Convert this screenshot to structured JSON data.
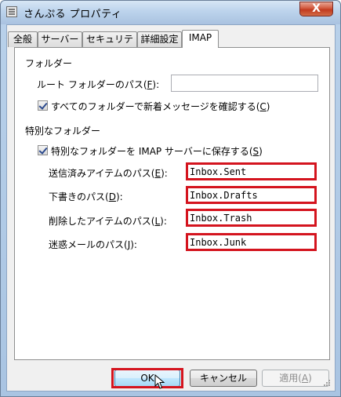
{
  "window": {
    "title": "さんぷる プロパティ",
    "close_glyph": "X"
  },
  "tabs": [
    {
      "label": "全般",
      "active": false
    },
    {
      "label": "サーバー",
      "active": false
    },
    {
      "label": "セキュリティ",
      "active": false
    },
    {
      "label": "詳細設定",
      "active": false
    },
    {
      "label": "IMAP",
      "active": true
    }
  ],
  "folders_group": {
    "heading": "フォルダー",
    "root_folder_label_pre": "ルート フォルダーのパス(",
    "root_folder_label_key": "F",
    "root_folder_label_post": "):",
    "root_folder_value": "",
    "check_all_label_pre": "すべてのフォルダーで新着メッセージを確認する(",
    "check_all_label_key": "C",
    "check_all_label_post": ")",
    "check_all_checked": true
  },
  "special_group": {
    "heading": "特別なフォルダー",
    "store_label_pre": "特別なフォルダーを IMAP サーバーに保存する(",
    "store_label_key": "S",
    "store_label_post": ")",
    "store_checked": true,
    "fields": [
      {
        "label_pre": "送信済みアイテムのパス(",
        "key": "E",
        "label_post": "):",
        "value": "Inbox.Sent"
      },
      {
        "label_pre": "下書きのパス(",
        "key": "D",
        "label_post": "):",
        "value": "Inbox.Drafts"
      },
      {
        "label_pre": "削除したアイテムのパス(",
        "key": "L",
        "label_post": "):",
        "value": "Inbox.Trash"
      },
      {
        "label_pre": "迷惑メールのパス(",
        "key": "J",
        "label_post": "):",
        "value": "Inbox.Junk"
      }
    ]
  },
  "buttons": {
    "ok": "OK",
    "cancel": "キャンセル",
    "apply_pre": "適用(",
    "apply_key": "A",
    "apply_post": ")"
  },
  "colors": {
    "highlight": "#d4141e"
  }
}
